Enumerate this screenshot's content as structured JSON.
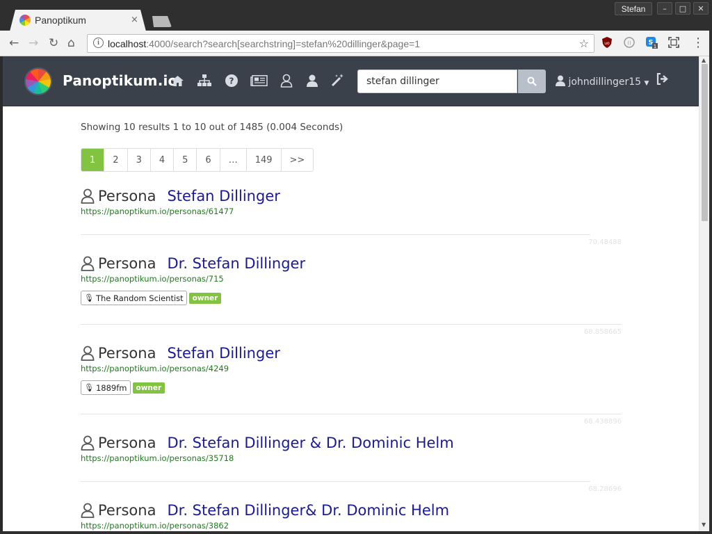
{
  "browser": {
    "tab_title": "Panoptikum",
    "tab_close": "×",
    "profile_name": "Stefan",
    "url_host": "localhost",
    "url_rest": ":4000/search?search[searchstring]=stefan%20dillinger&page=1",
    "window_buttons": [
      "minimize",
      "maximize",
      "close"
    ]
  },
  "navbar": {
    "brand": "Panoptikum.io",
    "search_value": "stefan dillinger",
    "username": "johndillinger15",
    "icons": [
      "home-icon",
      "sitemap-icon",
      "question-icon",
      "newspaper-icon",
      "persona-icon",
      "user-icon",
      "magic-icon"
    ]
  },
  "results_summary": "Showing 10 results 1 to 10 out of 1485 (0.004 Seconds)",
  "pagination": [
    "1",
    "2",
    "3",
    "4",
    "5",
    "6",
    "…",
    "149",
    ">>"
  ],
  "pagination_active": "1",
  "results": [
    {
      "type": "Persona",
      "name": "Stefan Dillinger",
      "url": "https://panoptikum.io/personas/61477",
      "score": "70.48488",
      "podcast": "",
      "role": ""
    },
    {
      "type": "Persona",
      "name": "Dr. Stefan Dillinger",
      "url": "https://panoptikum.io/personas/715",
      "score": "68.858665",
      "podcast": "The Random Scientist",
      "role": "owner"
    },
    {
      "type": "Persona",
      "name": "Stefan Dillinger",
      "url": "https://panoptikum.io/personas/4249",
      "score": "68.438896",
      "podcast": "1889fm",
      "role": "owner"
    },
    {
      "type": "Persona",
      "name": "Dr. Stefan Dillinger & Dr. Dominic Helm",
      "url": "https://panoptikum.io/personas/35718",
      "score": "68.28696",
      "podcast": "",
      "role": ""
    },
    {
      "type": "Persona",
      "name": "Dr. Stefan Dillinger& Dr. Dominic Helm",
      "url": "https://panoptikum.io/personas/3862",
      "score": "",
      "podcast": "",
      "role": ""
    }
  ]
}
